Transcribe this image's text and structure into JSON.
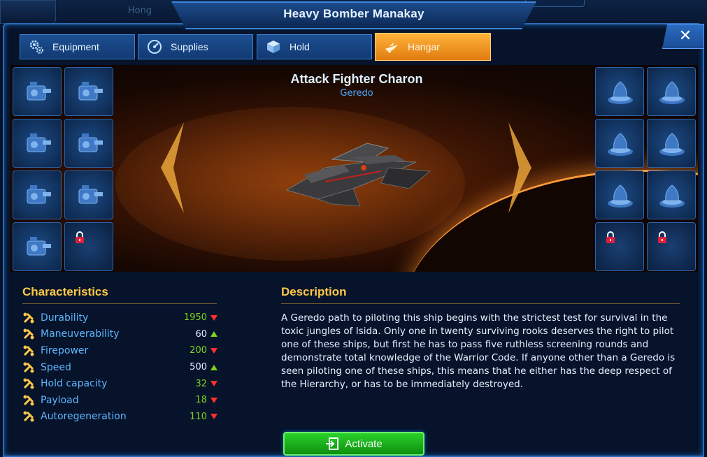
{
  "background": {
    "faded_name": "Hong"
  },
  "window": {
    "title": "Heavy Bomber Manakay",
    "close_label": "✕"
  },
  "tabs": [
    {
      "label": "Equipment",
      "icon": "gears-icon",
      "active": false
    },
    {
      "label": "Supplies",
      "icon": "gauge-icon",
      "active": false
    },
    {
      "label": "Hold",
      "icon": "cube-icon",
      "active": false
    },
    {
      "label": "Hangar",
      "icon": "fighter-icon",
      "active": true
    }
  ],
  "hangar": {
    "ship_name": "Attack Fighter Charon",
    "faction": "Geredo",
    "left_slots": [
      {
        "icon": "turret-icon",
        "locked": false
      },
      {
        "icon": "cannon-icon",
        "locked": false
      },
      {
        "icon": "engine-icon",
        "locked": false
      },
      {
        "icon": "armor-plate-icon",
        "locked": false
      },
      {
        "icon": "generator-icon",
        "locked": false
      },
      {
        "icon": "launcher-icon",
        "locked": false
      },
      {
        "icon": "reactor-icon",
        "locked": false
      },
      {
        "icon": "lock-icon",
        "locked": true
      }
    ],
    "right_slots": [
      {
        "icon": "hangar-bay-icon",
        "locked": false
      },
      {
        "icon": "hangar-bay-icon",
        "locked": false
      },
      {
        "icon": "hangar-bay-icon",
        "locked": false
      },
      {
        "icon": "hangar-bay-icon",
        "locked": false
      },
      {
        "icon": "hangar-bay-icon",
        "locked": false
      },
      {
        "icon": "hangar-bay-icon",
        "locked": false
      },
      {
        "icon": "lock-icon",
        "locked": true
      },
      {
        "icon": "lock-icon",
        "locked": true
      }
    ]
  },
  "characteristics": {
    "title": "Characteristics",
    "items": [
      {
        "label": "Durability",
        "value": "1950",
        "trend": "down",
        "value_color": "green"
      },
      {
        "label": "Maneuverability",
        "value": "60",
        "trend": "up",
        "value_color": "white"
      },
      {
        "label": "Firepower",
        "value": "200",
        "trend": "down",
        "value_color": "green"
      },
      {
        "label": "Speed",
        "value": "500",
        "trend": "up",
        "value_color": "white"
      },
      {
        "label": "Hold capacity",
        "value": "32",
        "trend": "down",
        "value_color": "green"
      },
      {
        "label": "Payload",
        "value": "18",
        "trend": "down",
        "value_color": "green"
      },
      {
        "label": "Autoregeneration",
        "value": "110",
        "trend": "down",
        "value_color": "green"
      }
    ]
  },
  "description": {
    "title": "Description",
    "text": "A Geredo path to piloting this ship begins with the strictest test for survival in the toxic jungles of Isida. Only one in twenty surviving rooks deserves the right to pilot one of these ships, but first he has to pass five ruthless screening rounds and demonstrate total knowledge of the Warrior Code. If anyone other than a Geredo is seen piloting one of these ships, this means that he either has the deep respect of the Hierarchy, or has to be immediately destroyed."
  },
  "actions": {
    "activate_label": "Activate"
  },
  "colors": {
    "accent_gold": "#ffc847",
    "tab_active": "#f0961e",
    "frame_blue": "#2b6cb8",
    "stat_label": "#5fb6ff",
    "trend_up": "#7ed321",
    "trend_down": "#ff3030",
    "activate_green": "#1fb81f"
  }
}
